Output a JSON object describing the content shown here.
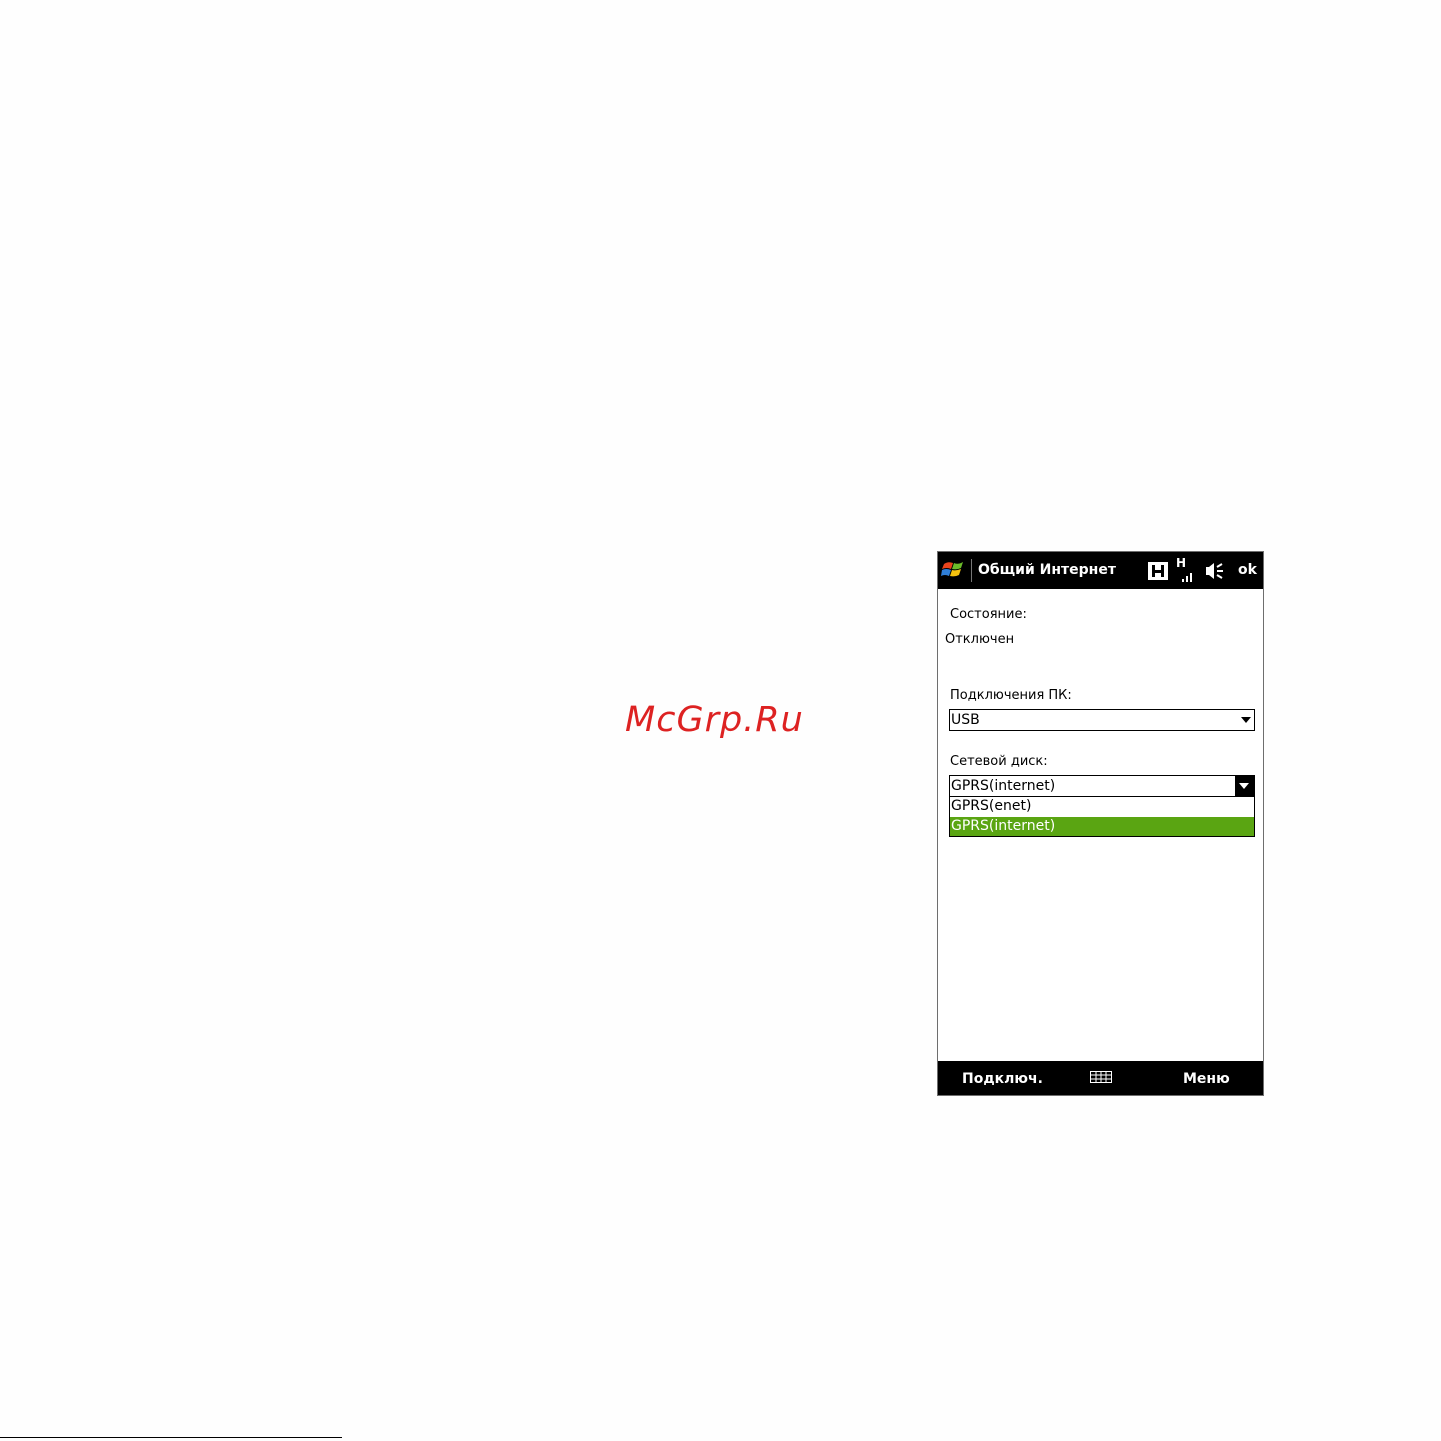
{
  "watermark": "McGrp.Ru",
  "footer": {
    "text": ""
  },
  "window": {
    "title": "Общий Интернет",
    "ok_label": "ok",
    "start_icon": "windows-flag-icon",
    "status_icons": [
      "hsdpa-h-icon",
      "signal-strength-icon",
      "speaker-icon"
    ],
    "status_signal_label": "H"
  },
  "form": {
    "status_label": "Состояние:",
    "status_value": "Отключен",
    "pc_connection_label": "Подключения ПК:",
    "pc_connection_value": "USB",
    "network_label": "Сетевой диск:",
    "network_value": "GPRS(internet)",
    "network_options": [
      "GPRS(enet)",
      "GPRS(internet)"
    ],
    "network_selected_index": 1,
    "accent_color": "#5aa512"
  },
  "softkeys": {
    "left": "Подключ.",
    "center_icon": "keyboard-icon",
    "right": "Меню"
  }
}
